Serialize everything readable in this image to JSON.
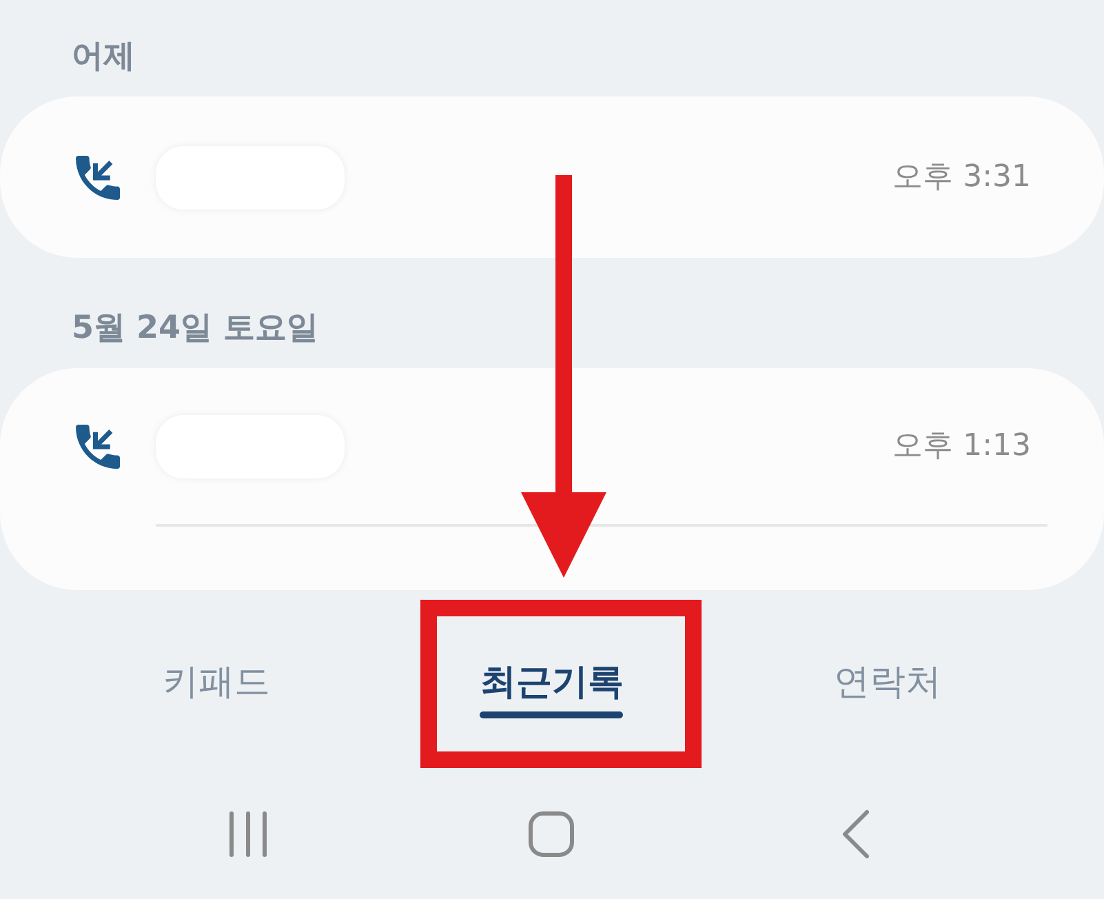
{
  "sections": [
    {
      "heading": "어제",
      "calls": [
        {
          "kind": "incoming",
          "time": "오후 3:31",
          "divider": false
        }
      ]
    },
    {
      "heading": "5월 24일 토요일",
      "calls": [
        {
          "kind": "incoming",
          "time": "오후 1:13",
          "divider": true
        }
      ]
    }
  ],
  "tabs": [
    {
      "label": "키패드",
      "selected": false,
      "highlighted": false
    },
    {
      "label": "최근기록",
      "selected": true,
      "highlighted": true
    },
    {
      "label": "연락처",
      "selected": false,
      "highlighted": false
    }
  ],
  "arrow_annotation": true
}
